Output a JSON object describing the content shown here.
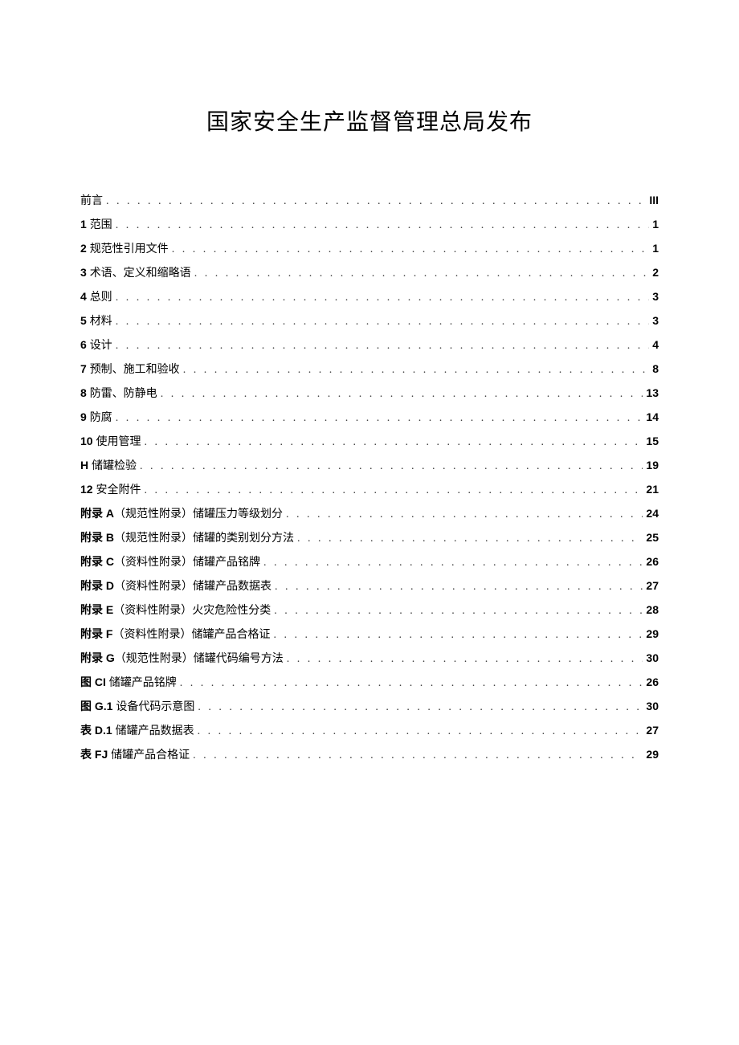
{
  "title": "国家安全生产监督管理总局发布",
  "toc": [
    {
      "label": "前言",
      "page": "III",
      "prefix": ""
    },
    {
      "label": "范围",
      "page": "1",
      "prefix": "1 "
    },
    {
      "label": "规范性引用文件",
      "page": "1",
      "prefix": "2 "
    },
    {
      "label": "术语、定义和缩略语",
      "page": "2",
      "prefix": "3 "
    },
    {
      "label": "总则",
      "page": "3",
      "prefix": "4 "
    },
    {
      "label": "材料",
      "page": "3",
      "prefix": "5 "
    },
    {
      "label": "设计",
      "page": "4",
      "prefix": "6 "
    },
    {
      "label": "预制、施工和验收",
      "page": "8",
      "prefix": "7 "
    },
    {
      "label": "防雷、防静电",
      "page": "13",
      "prefix": "8 "
    },
    {
      "label": "防腐",
      "page": "14",
      "prefix": "9 "
    },
    {
      "label": "使用管理",
      "page": "15",
      "prefix": "10 "
    },
    {
      "label": "储罐检验",
      "page": "19",
      "prefix": "H "
    },
    {
      "label": "安全附件",
      "page": "21",
      "prefix": "12 "
    },
    {
      "label": "（规范性附录）储罐压力等级划分",
      "page": "24",
      "prefix": "附录 A"
    },
    {
      "label": "（规范性附录）储罐的类别划分方法",
      "page": "25",
      "prefix": "附录 B"
    },
    {
      "label": "（资料性附录）储罐产品铭牌",
      "page": "26",
      "prefix": "附录 C"
    },
    {
      "label": "（资料性附录）储罐产品数据表",
      "page": "27",
      "prefix": "附录 D"
    },
    {
      "label": "（资料性附录）火灾危险性分类",
      "page": "28",
      "prefix": "附录 E"
    },
    {
      "label": "（资料性附录）储罐产品合格证",
      "page": "29",
      "prefix": "附录 F"
    },
    {
      "label": "（规范性附录）储罐代码编号方法",
      "page": "30",
      "prefix": "附录 G"
    },
    {
      "label": "储罐产品铭牌",
      "page": "26",
      "prefix": "图 CI "
    },
    {
      "label": "设备代码示意图",
      "page": "30",
      "prefix": "图 G.1 "
    },
    {
      "label": "储罐产品数据表",
      "page": "27",
      "prefix": "表 D.1 "
    },
    {
      "label": "储罐产品合格证",
      "page": "29",
      "prefix": "表 FJ "
    }
  ]
}
